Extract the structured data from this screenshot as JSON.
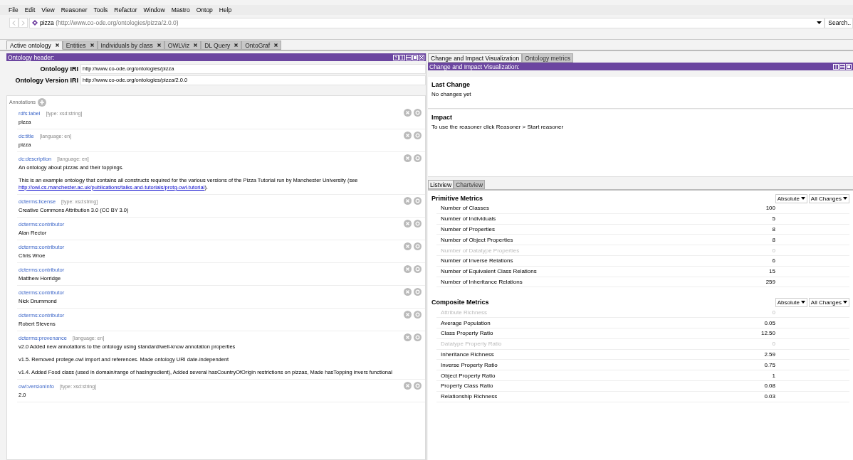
{
  "menu": [
    "File",
    "Edit",
    "View",
    "Reasoner",
    "Tools",
    "Refactor",
    "Window",
    "Mastro",
    "Ontop",
    "Help"
  ],
  "address": {
    "name": "pizza",
    "iri": "(http://www.co-ode.org/ontologies/pizza/2.0.0)"
  },
  "search_button": "Search..",
  "tabs": [
    {
      "label": "Active ontology",
      "selected": true
    },
    {
      "label": "Entities",
      "selected": false
    },
    {
      "label": "Individuals by class",
      "selected": false
    },
    {
      "label": "OWLViz",
      "selected": false
    },
    {
      "label": "DL Query",
      "selected": false
    },
    {
      "label": "OntoGraf",
      "selected": false
    }
  ],
  "ontology_header": {
    "title": "Ontology header:",
    "iri_label": "Ontology IRI",
    "iri": "http://www.co-ode.org/ontologies/pizza",
    "version_iri_label": "Ontology Version IRI",
    "version_iri": "http://www.co-ode.org/ontologies/pizza/2.0.0",
    "annotations_label": "Annotations",
    "annotations": [
      {
        "property": "rdfs:label",
        "meta": "[type: xsd:string]",
        "paragraphs": [
          {
            "text": "pizza"
          }
        ]
      },
      {
        "property": "dc:title",
        "meta": "[language: en]",
        "paragraphs": [
          {
            "text": "pizza"
          }
        ]
      },
      {
        "property": "dc:description",
        "meta": "[language: en]",
        "paragraphs": [
          {
            "text": "An ontology about pizzas and their toppings."
          },
          {
            "text": "This is an example ontology that contains all constructs required for the various versions of the Pizza Tutorial run by Manchester University (see",
            "link": "http://owl.cs.manchester.ac.uk/publications/talks-and-tutorials/protg-owl-tutorial",
            "after": ")."
          }
        ]
      },
      {
        "property": "dcterms:license",
        "meta": "[type: xsd:string]",
        "paragraphs": [
          {
            "text": "Creative Commons Attribution 3.0 (CC BY 3.0)"
          }
        ]
      },
      {
        "property": "dcterms:contributor",
        "paragraphs": [
          {
            "text": "Alan Rector"
          }
        ]
      },
      {
        "property": "dcterms:contributor",
        "paragraphs": [
          {
            "text": "Chris Wroe"
          }
        ]
      },
      {
        "property": "dcterms:contributor",
        "paragraphs": [
          {
            "text": "Matthew Horridge"
          }
        ]
      },
      {
        "property": "dcterms:contributor",
        "paragraphs": [
          {
            "text": "Nick Drummond"
          }
        ]
      },
      {
        "property": "dcterms:contributor",
        "paragraphs": [
          {
            "text": "Robert Stevens"
          }
        ]
      },
      {
        "property": "dcterms:provenance",
        "meta": "[language: en]",
        "paragraphs": [
          {
            "text": "v2.0 Added new annotations to the ontology using standard/well-know annotation properties"
          },
          {
            "text": "v1.5. Removed protege.owl import and references. Made ontology URI date-independent"
          },
          {
            "text": "v1.4. Added Food class (used in domain/range of hasIngredient), Added several hasCountryOfOrigin restrictions on pizzas, Made hasTopping invers functional"
          }
        ]
      },
      {
        "property": "owl:versionInfo",
        "meta": "[type: xsd:string]",
        "paragraphs": [
          {
            "text": "2.0"
          }
        ]
      }
    ]
  },
  "right_tabs": [
    {
      "label": "Change and Impact Visualization",
      "selected": true
    },
    {
      "label": "Ontology metrics",
      "selected": false
    }
  ],
  "change_view": {
    "title": "Change and Impact Visualization:",
    "last_change_title": "Last Change",
    "last_change": "No changes yet",
    "impact_title": "Impact",
    "impact": "To use the reasoner click Reasoner > Start reasoner"
  },
  "view_tabs": [
    {
      "label": "Listview",
      "selected": true
    },
    {
      "label": "Chartview",
      "selected": false
    }
  ],
  "metric_groups": [
    {
      "title": "Primitive Metrics",
      "mode": "Absolute",
      "scope": "All Changes",
      "rows": [
        {
          "label": "Number of Classes",
          "value": "100",
          "disabled": false
        },
        {
          "label": "Number of Individuals",
          "value": "5",
          "disabled": false
        },
        {
          "label": "Number of Properties",
          "value": "8",
          "disabled": false
        },
        {
          "label": "Number of Object Properties",
          "value": "8",
          "disabled": false
        },
        {
          "label": "Number of Datatype Properties",
          "value": "0",
          "disabled": true
        },
        {
          "label": "Number of Inverse Relations",
          "value": "6",
          "disabled": false
        },
        {
          "label": "Number of Equivalent Class Relations",
          "value": "15",
          "disabled": false
        },
        {
          "label": "Number of Inheritance Relations",
          "value": "259",
          "disabled": false
        }
      ]
    },
    {
      "title": "Composite Metrics",
      "mode": "Absolute",
      "scope": "All Changes",
      "rows": [
        {
          "label": "Attribute Richness",
          "value": "0",
          "disabled": true
        },
        {
          "label": "Average Population",
          "value": "0.05",
          "disabled": false
        },
        {
          "label": "Class Property Ratio",
          "value": "12.50",
          "disabled": false
        },
        {
          "label": "Datatype Property Ratio",
          "value": "0",
          "disabled": true
        },
        {
          "label": "Inheritance Richness",
          "value": "2.59",
          "disabled": false
        },
        {
          "label": "Inverse Property Ratio",
          "value": "0.75",
          "disabled": false
        },
        {
          "label": "Object Property Ratio",
          "value": "1",
          "disabled": false
        },
        {
          "label": "Property Class Ratio",
          "value": "0.08",
          "disabled": false
        },
        {
          "label": "Relationship Richness",
          "value": "0.03",
          "disabled": false
        }
      ]
    }
  ]
}
